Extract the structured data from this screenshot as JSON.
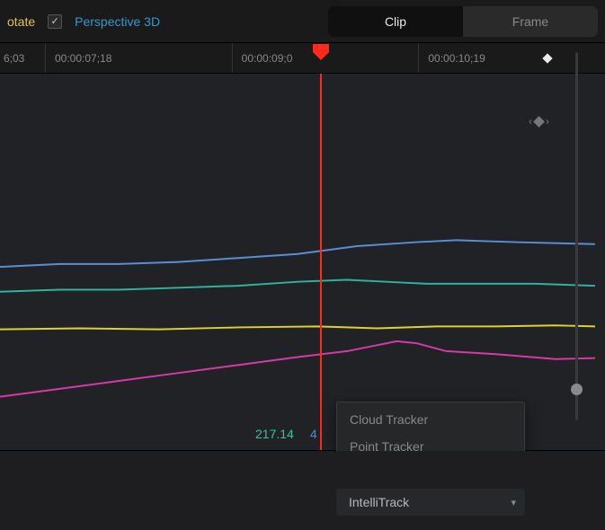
{
  "top": {
    "rotate_label": "otate",
    "perspective_label": "Perspective 3D",
    "perspective_checked": true,
    "mode_clip": "Clip",
    "mode_frame": "Frame",
    "active_mode": "Clip"
  },
  "ruler": {
    "ticks": [
      "6;03",
      "00:00:07;18",
      "00:00:09;0",
      "00:00:10;19"
    ]
  },
  "readouts": {
    "green": "217.14",
    "blue_partial": "4"
  },
  "menu": {
    "items": [
      "Cloud Tracker",
      "Point Tracker",
      "IntelliTrack"
    ],
    "selected": "IntelliTrack"
  },
  "dropdown": {
    "label": "IntelliTrack"
  },
  "chart_data": {
    "type": "line",
    "xlim": [
      0,
      600
    ],
    "ylim": [
      0,
      420
    ],
    "series": [
      {
        "name": "blue",
        "color": "#5b8dd6",
        "points": [
          [
            0,
            195
          ],
          [
            60,
            192
          ],
          [
            120,
            192
          ],
          [
            180,
            190
          ],
          [
            240,
            186
          ],
          [
            300,
            182
          ],
          [
            360,
            174
          ],
          [
            420,
            170
          ],
          [
            460,
            168
          ],
          [
            520,
            170
          ],
          [
            600,
            172
          ]
        ]
      },
      {
        "name": "green",
        "color": "#2fb39a",
        "points": [
          [
            0,
            220
          ],
          [
            60,
            218
          ],
          [
            120,
            218
          ],
          [
            180,
            216
          ],
          [
            240,
            214
          ],
          [
            300,
            210
          ],
          [
            350,
            208
          ],
          [
            390,
            210
          ],
          [
            430,
            212
          ],
          [
            480,
            212
          ],
          [
            540,
            212
          ],
          [
            600,
            214
          ]
        ]
      },
      {
        "name": "yellow",
        "color": "#d8d32d",
        "points": [
          [
            0,
            258
          ],
          [
            80,
            257
          ],
          [
            160,
            258
          ],
          [
            240,
            256
          ],
          [
            320,
            255
          ],
          [
            380,
            257
          ],
          [
            440,
            255
          ],
          [
            500,
            255
          ],
          [
            560,
            254
          ],
          [
            600,
            255
          ]
        ]
      },
      {
        "name": "magenta",
        "color": "#d53aa8",
        "points": [
          [
            0,
            326
          ],
          [
            60,
            318
          ],
          [
            120,
            310
          ],
          [
            180,
            302
          ],
          [
            240,
            294
          ],
          [
            300,
            286
          ],
          [
            350,
            280
          ],
          [
            380,
            274
          ],
          [
            400,
            270
          ],
          [
            420,
            272
          ],
          [
            450,
            280
          ],
          [
            500,
            283
          ],
          [
            560,
            288
          ],
          [
            600,
            287
          ]
        ]
      }
    ],
    "playhead_x": 356
  }
}
